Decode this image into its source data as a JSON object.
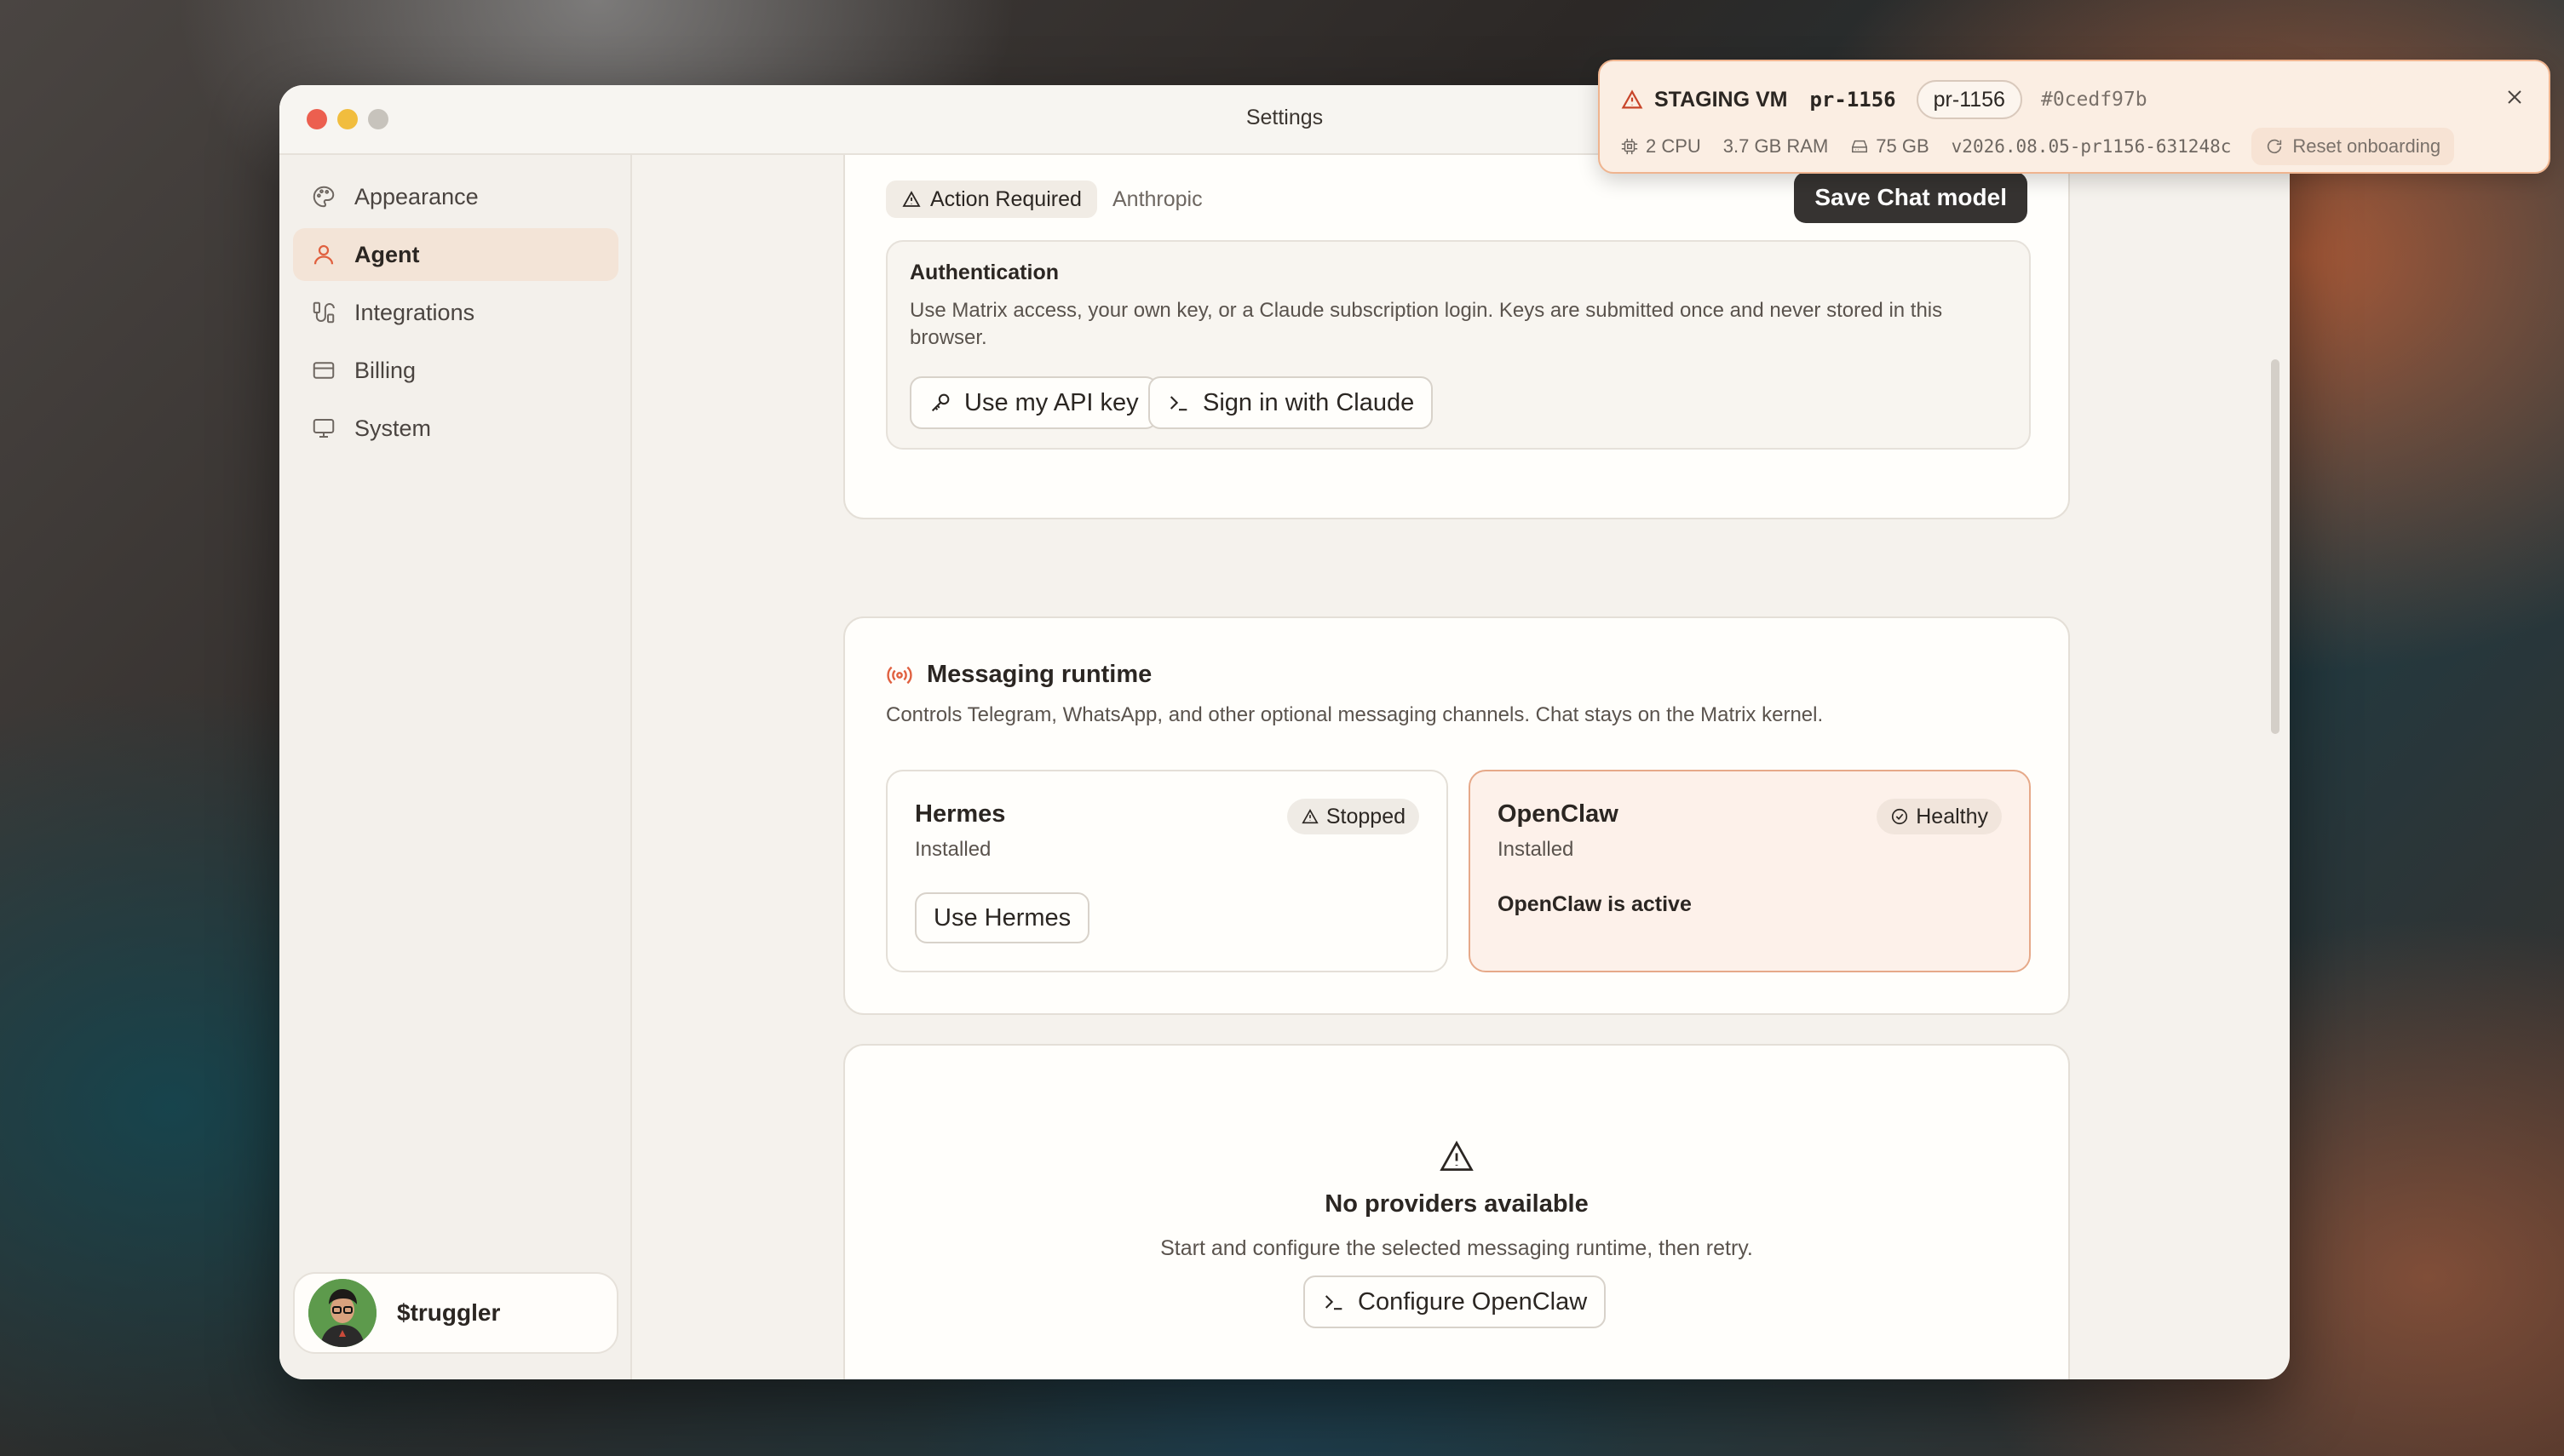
{
  "window": {
    "title": "Settings"
  },
  "sidebar": {
    "items": [
      {
        "label": "Appearance",
        "icon": "palette-icon",
        "active": false
      },
      {
        "label": "Agent",
        "icon": "user-icon",
        "active": true
      },
      {
        "label": "Integrations",
        "icon": "integrations-icon",
        "active": false
      },
      {
        "label": "Billing",
        "icon": "credit-card-icon",
        "active": false
      },
      {
        "label": "System",
        "icon": "monitor-icon",
        "active": false
      }
    ],
    "user": {
      "name": "$truggler",
      "avatar_icon": "avatar-image"
    }
  },
  "chat_model": {
    "status_label": "Action Required",
    "provider": "Anthropic",
    "save_label": "Save Chat model",
    "auth": {
      "title": "Authentication",
      "description": "Use Matrix access, your own key, or a Claude subscription login. Keys are submitted once and never stored in this browser.",
      "api_key_label": "Use my API key",
      "claude_label": "Sign in with Claude"
    }
  },
  "messaging_runtime": {
    "title": "Messaging runtime",
    "description": "Controls Telegram, WhatsApp, and other optional messaging channels. Chat stays on the Matrix kernel.",
    "runtimes": [
      {
        "name": "Hermes",
        "status": "Installed",
        "badge": "Stopped",
        "action_label": "Use Hermes"
      },
      {
        "name": "OpenClaw",
        "status": "Installed",
        "badge": "Healthy",
        "active_text": "OpenClaw is active"
      }
    ]
  },
  "providers": {
    "empty_title": "No providers available",
    "empty_description": "Start and configure the selected messaging runtime, then retry.",
    "configure_label": "Configure OpenClaw"
  },
  "staging_toast": {
    "label": "STAGING VM",
    "branch": "pr-1156",
    "chip": "pr-1156",
    "hash": "#0cedf97b",
    "cpu": "2 CPU",
    "ram": "3.7 GB RAM",
    "disk": "75 GB",
    "version": "v2026.08.05-pr1156-631248c",
    "reset_label": "Reset onboarding"
  },
  "colors": {
    "accent": "#e0603f",
    "active_nav_bg": "#f3e4d7",
    "toast_bg": "#fbeee3",
    "toast_border": "#efb48f",
    "save_button_bg": "#363331"
  }
}
